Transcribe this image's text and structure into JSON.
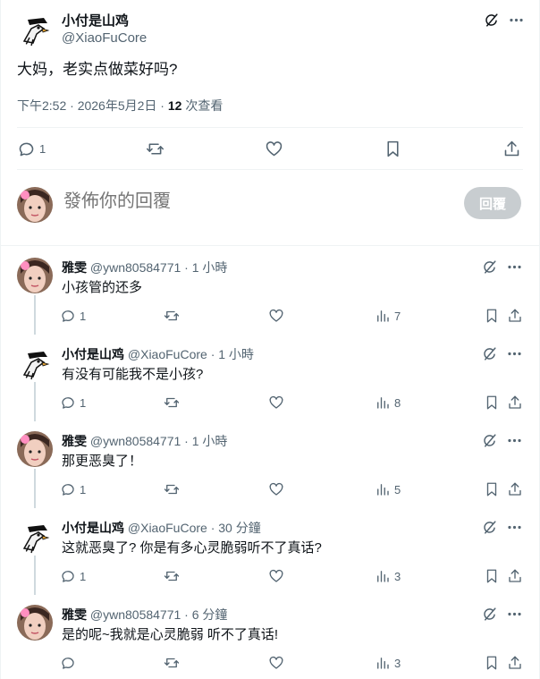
{
  "main_tweet": {
    "author_name": "小付是山鸡",
    "author_handle": "@XiaoFuCore",
    "text": "大妈，老实点做菜好吗?",
    "timestamp": "下午2:52 · 2026年5月2日 · ",
    "views_count": "12",
    "views_label": " 次查看",
    "replies": "1",
    "icons": [
      "grok-icon",
      "more-icon",
      "reply-icon",
      "retweet-icon",
      "like-icon",
      "bookmark-icon",
      "share-icon"
    ]
  },
  "composer": {
    "placeholder": "發佈你的回覆",
    "button_label": "回覆"
  },
  "replies": [
    {
      "avatar": "girl",
      "name": "雅雯",
      "handle": "@ywn80584771",
      "time": " · 1 小時",
      "text": "小孩管的还多",
      "reply_count": "1",
      "views": "7"
    },
    {
      "avatar": "chicken",
      "name": "小付是山鸡",
      "handle": "@XiaoFuCore",
      "time": " · 1 小時",
      "text": "有没有可能我不是小孩?",
      "reply_count": "1",
      "views": "8"
    },
    {
      "avatar": "girl",
      "name": "雅雯",
      "handle": "@ywn80584771",
      "time": " · 1 小時",
      "text": "那更恶臭了！",
      "reply_count": "1",
      "views": "5"
    },
    {
      "avatar": "chicken",
      "name": "小付是山鸡",
      "handle": "@XiaoFuCore",
      "time": " · 30 分鐘",
      "text": "这就恶臭了? 你是有多心灵脆弱听不了真话?",
      "reply_count": "1",
      "views": "3"
    },
    {
      "avatar": "girl",
      "name": "雅雯",
      "handle": "@ywn80584771",
      "time": " · 6 分鐘",
      "text": "是的呢~我就是心灵脆弱 听不了真话!",
      "reply_count": "",
      "views": "3"
    }
  ],
  "colors": {
    "text": "#0f1419",
    "muted": "#536471",
    "divider": "#eff3f4",
    "thread": "#cfd9de",
    "button_disabled": "#c8cdd0"
  }
}
